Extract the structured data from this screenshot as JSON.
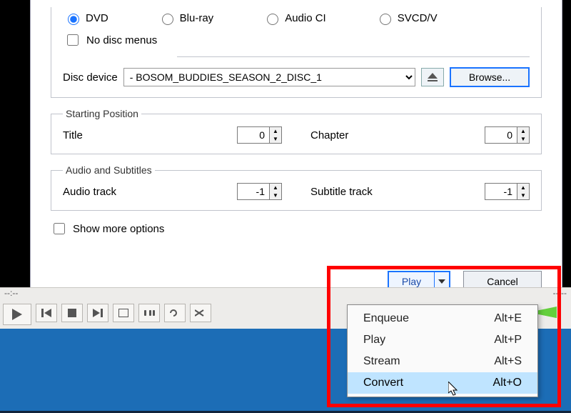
{
  "disc_selection": {
    "radios": {
      "dvd": "DVD",
      "bluray": "Blu-ray",
      "audiocd": "Audio CI",
      "svcd": "SVCD/V"
    },
    "no_disc_menus": "No disc menus",
    "device_label": "Disc device",
    "device_value": "- BOSOM_BUDDIES_SEASON_2_DISC_1",
    "browse": "Browse..."
  },
  "starting_position": {
    "legend": "Starting Position",
    "title_label": "Title",
    "title_value": "0",
    "chapter_label": "Chapter",
    "chapter_value": "0"
  },
  "audio_subtitles": {
    "legend": "Audio and Subtitles",
    "audio_label": "Audio track",
    "audio_value": "-1",
    "subtitle_label": "Subtitle track",
    "subtitle_value": "-1"
  },
  "show_more": "Show more options",
  "buttons": {
    "play": "Play",
    "cancel": "Cancel"
  },
  "menu": {
    "items": [
      {
        "label": "Enqueue",
        "accel": "Alt+E"
      },
      {
        "label": "Play",
        "accel": "Alt+P"
      },
      {
        "label": "Stream",
        "accel": "Alt+S"
      },
      {
        "label": "Convert",
        "accel": "Alt+O"
      }
    ],
    "selected_index": 3
  },
  "player": {
    "time_l": "--:--",
    "time_r": "--:--"
  }
}
